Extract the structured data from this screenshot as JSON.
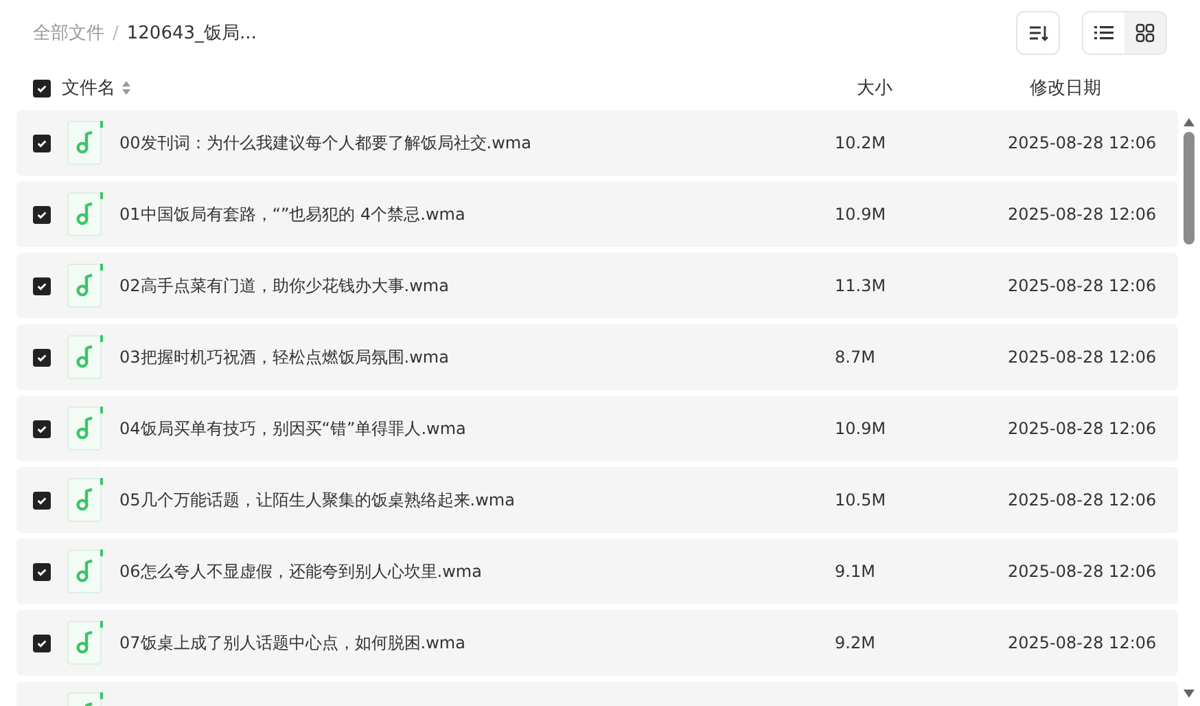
{
  "breadcrumb": [
    {
      "label": "全部文件",
      "current": false
    },
    {
      "label": "120643_饭局...",
      "current": true
    }
  ],
  "separator": "/",
  "view_toggle": [
    {
      "kind": "list",
      "selected": false
    },
    {
      "kind": "grid",
      "selected": true
    }
  ],
  "table": {
    "select_all": {
      "checked": true
    },
    "columns": [
      "文件名",
      "大小",
      "修改日期"
    ],
    "rows": [
      {
        "checked": true,
        "name": "00发刊词：为什么我建议每个人都要了解饭局社交.wma",
        "size": "10.2M",
        "modified": "2025-08-28 12:06"
      },
      {
        "checked": true,
        "name": "01中国饭局有套路，“”也易犯的 4个禁忌.wma",
        "size": "10.9M",
        "modified": "2025-08-28 12:06"
      },
      {
        "checked": true,
        "name": "02高手点菜有门道，助你少花钱办大事.wma",
        "size": "11.3M",
        "modified": "2025-08-28 12:06"
      },
      {
        "checked": true,
        "name": "03把握时机巧祝酒，轻松点燃饭局氛围.wma",
        "size": "8.7M",
        "modified": "2025-08-28 12:06"
      },
      {
        "checked": true,
        "name": "04饭局买单有技巧，别因买“错”单得罪人.wma",
        "size": "10.9M",
        "modified": "2025-08-28 12:06"
      },
      {
        "checked": true,
        "name": "05几个万能话题，让陌生人聚集的饭桌熟络起来.wma",
        "size": "10.5M",
        "modified": "2025-08-28 12:06"
      },
      {
        "checked": true,
        "name": "06怎么夸人不显虚假，还能夸到别人心坎里.wma",
        "size": "9.1M",
        "modified": "2025-08-28 12:06"
      },
      {
        "checked": true,
        "name": "07饭桌上成了别人话题中心点，如何脱困.wma",
        "size": "9.2M",
        "modified": "2025-08-28 12:06"
      },
      {}
    ]
  }
}
